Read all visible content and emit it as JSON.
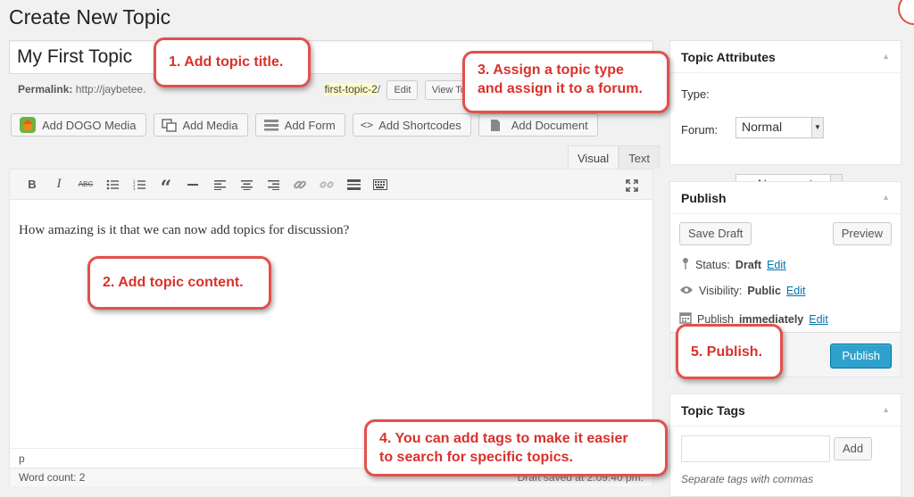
{
  "page_title": "Create New Topic",
  "title_input": {
    "value": "My First Topic"
  },
  "permalink": {
    "label": "Permalink:",
    "url_prefix": "http://jaybetee.",
    "slug_visible": "first-topic-2",
    "suffix": "/",
    "edit_label": "Edit",
    "view_label": "View Topic"
  },
  "media_buttons": {
    "dogo": "Add DOGO Media",
    "media": "Add Media",
    "form": "Add Form",
    "shortcodes": "Add Shortcodes",
    "document": "Add Document"
  },
  "editor_tabs": {
    "visual": "Visual",
    "text": "Text"
  },
  "editor": {
    "content": "How amazing is it that we can now add topics for discussion?",
    "path": "p",
    "word_count": "Word count: 2",
    "draft_saved": "Draft saved at 2:09:40 pm."
  },
  "topic_attributes": {
    "title": "Topic Attributes",
    "type_label": "Type:",
    "type_value": "Normal",
    "forum_label": "Forum:",
    "forum_value": "— No parent —"
  },
  "publish_box": {
    "title": "Publish",
    "save_draft": "Save Draft",
    "preview": "Preview",
    "status_label": "Status:",
    "status_value": "Draft",
    "visibility_label": "Visibility:",
    "visibility_value": "Public",
    "publish_label": "Publish",
    "publish_value": "immediately",
    "edit": "Edit",
    "publish_button": "Publish"
  },
  "topic_tags": {
    "title": "Topic Tags",
    "input_value": "",
    "add_button": "Add",
    "help": "Separate tags with commas"
  },
  "callouts": {
    "c1": "1. Add topic title.",
    "c2": "2. Add topic content.",
    "c3_line1": "3. Assign a topic type",
    "c3_line2": "and assign it to a forum.",
    "c4_line1": "4. You can add tags to make it easier",
    "c4_line2": "to search for specific topics.",
    "c5": "5. Publish."
  },
  "colors": {
    "accent_red": "#e2514a",
    "publish_blue": "#2ea2cc",
    "link_blue": "#0073aa"
  }
}
